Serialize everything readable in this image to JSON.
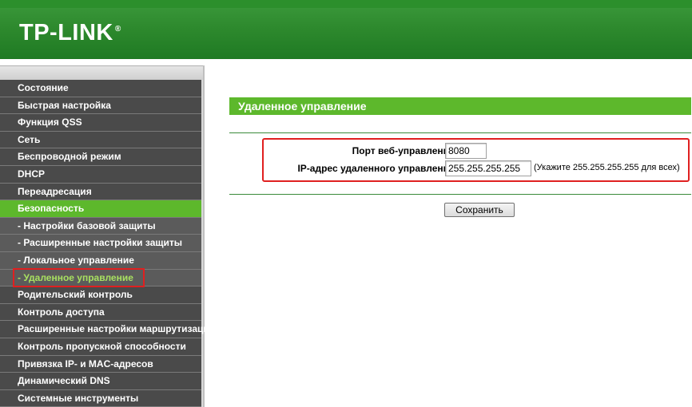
{
  "header": {
    "logo_text": "TP-LINK",
    "logo_mark": "®",
    "brand_color": "#2e8a2e"
  },
  "sidebar": {
    "items": [
      {
        "label": "Состояние"
      },
      {
        "label": "Быстрая настройка"
      },
      {
        "label": "Функция QSS"
      },
      {
        "label": "Сеть"
      },
      {
        "label": "Беспроводной режим"
      },
      {
        "label": "DHCP"
      },
      {
        "label": "Переадресация"
      },
      {
        "label": "Безопасность",
        "active": true
      },
      {
        "label": "- Настройки базовой защиты",
        "sub": true
      },
      {
        "label": "- Расширенные настройки защиты",
        "sub": true
      },
      {
        "label": "- Локальное управление",
        "sub": true
      },
      {
        "label": "- Удаленное управление",
        "sub": true,
        "current": true
      },
      {
        "label": "Родительский контроль"
      },
      {
        "label": "Контроль доступа"
      },
      {
        "label": "Расширенные настройки маршрутизации"
      },
      {
        "label": "Контроль пропускной способности"
      },
      {
        "label": "Привязка IP- и MAC-адресов"
      },
      {
        "label": "Динамический DNS"
      },
      {
        "label": "Системные инструменты"
      }
    ],
    "active_color": "#5db82c",
    "current_text_color": "#a8e060"
  },
  "main": {
    "title": "Удаленное управление",
    "form": {
      "port_label": "Порт веб-управления:",
      "port_value": "8080",
      "ip_label": "IP-адрес удаленного управления:",
      "ip_value": "255.255.255.255",
      "ip_hint": "(Укажите 255.255.255.255 для всех)"
    },
    "save_label": "Сохранить",
    "highlight_color": "#e02020"
  }
}
